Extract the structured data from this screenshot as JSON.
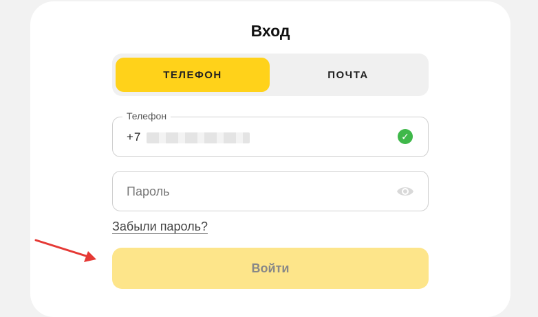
{
  "title": "Вход",
  "tabs": [
    {
      "label": "ТЕЛЕФОН",
      "active": true
    },
    {
      "label": "ПОЧТА",
      "active": false
    }
  ],
  "phone_field": {
    "label": "Телефон",
    "value": "+7 ",
    "status_icon": "check-circle-icon"
  },
  "password_field": {
    "placeholder": "Пароль",
    "toggle_icon": "eye-icon"
  },
  "forgot_link": "Забыли пароль?",
  "login_button": "Войти",
  "colors": {
    "accent": "#ffd21a",
    "button_disabled": "#fde58a",
    "success": "#3fb84a",
    "annotation_arrow": "#e53935"
  }
}
